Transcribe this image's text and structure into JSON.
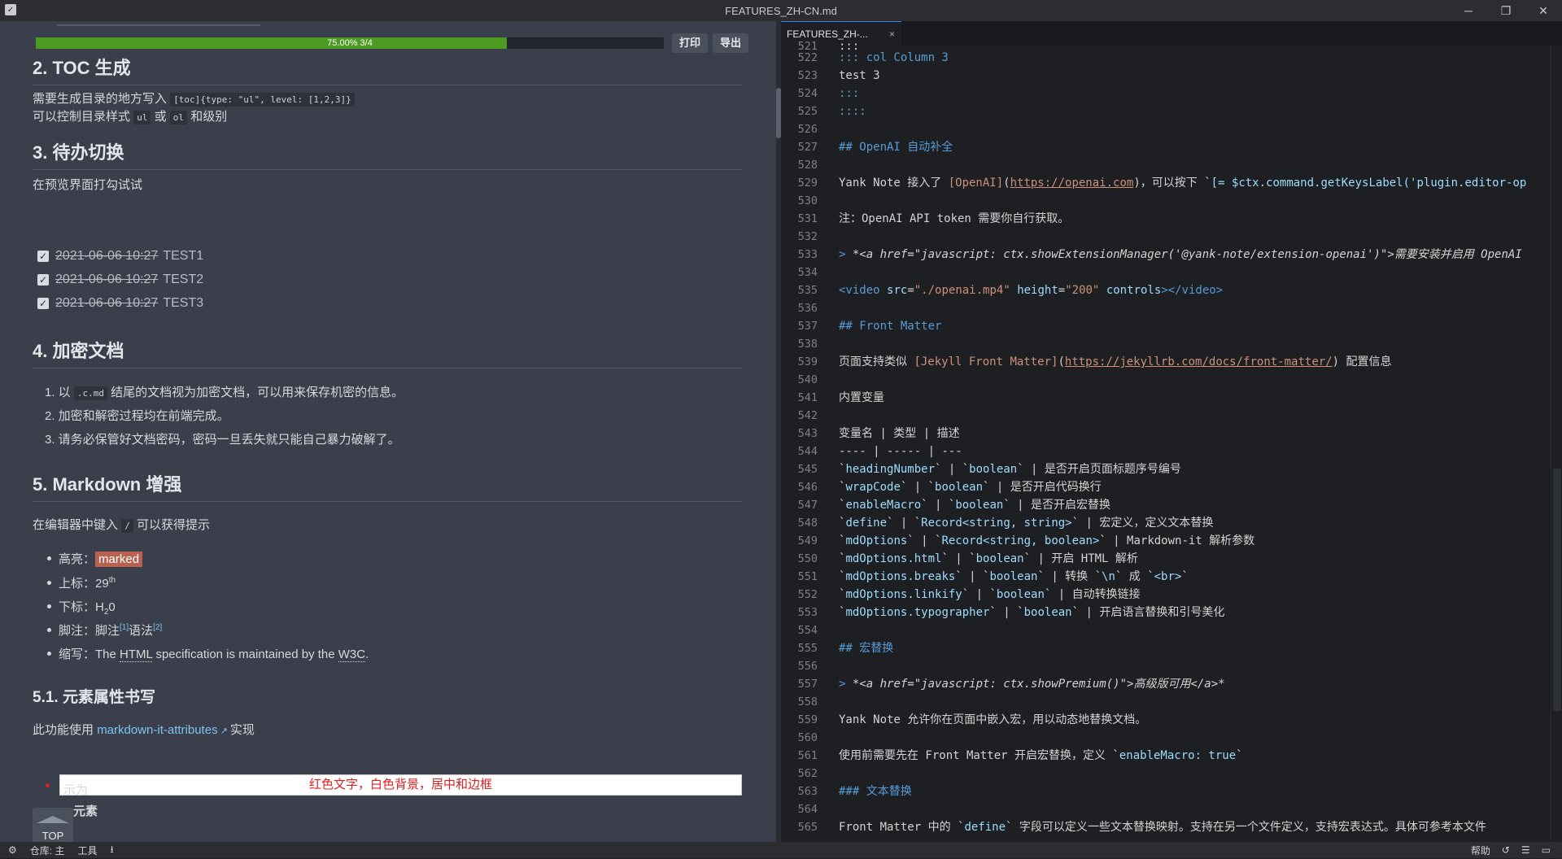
{
  "window": {
    "title": "FEATURES_ZH-CN.md",
    "minimize": "─",
    "maximize": "❐",
    "close": "✕"
  },
  "preview": {
    "progress": {
      "fraction": 0.75,
      "label": "75.00% 3/4"
    },
    "buttons": {
      "print": "打印",
      "export": "导出"
    },
    "sections": {
      "toc_heading": "2.  TOC 生成",
      "toc_line1_prefix": "需要生成目录的地方写入",
      "toc_line1_code": "[toc]{type: \"ul\", level: [1,2,3]}",
      "toc_line2_prefix": "可以控制目录样式",
      "toc_line2_code1": "ul",
      "toc_line2_mid": "或",
      "toc_line2_code2": "ol",
      "toc_line2_suffix": "和级别",
      "todo_heading": "3.  待办切换",
      "todo_intro": "在预览界面打勾试试",
      "tasks": [
        {
          "date": "2021-06-06 10:27",
          "name": "TEST1",
          "check": "✓"
        },
        {
          "date": "2021-06-06 10:27",
          "name": "TEST2",
          "check": "✓"
        },
        {
          "date": "2021-06-06 10:27",
          "name": "TEST3",
          "check": "✓"
        }
      ],
      "enc_heading": "4.  加密文档",
      "enc_items": {
        "i1_prefix": "1. 以",
        "i1_code": ".c.md",
        "i1_suffix": "结尾的文档视为加密文档，可以用来保存机密的信息。",
        "i2": "2. 加密和解密过程均在前端完成。",
        "i3": "3. 请务必保管好文档密码，密码一旦丢失就只能自己暴力破解了。"
      },
      "md_heading": "5.  Markdown 增强",
      "md_intro_prefix": "在编辑器中键入",
      "md_intro_code": "/",
      "md_intro_suffix": "可以获得提示",
      "md_items": {
        "highlight_label": "高亮：",
        "highlight_value": "marked",
        "sup_label": "上标：29",
        "sup_value": "th",
        "sub_label": "下标：H",
        "sub_value": "2",
        "sub_suffix": "0",
        "fn_label": "脚注：脚注",
        "fn_ref1": "[1]",
        "fn_mid": "语法",
        "fn_ref2": "[2]",
        "abbr_label": "缩写：The ",
        "abbr1": "HTML",
        "abbr_mid": " specification is maintained by the ",
        "abbr2": "W3C",
        "abbr_end": "."
      },
      "attr_heading": "5.1.  元素属性书写",
      "attr_intro_prefix": "此功能使用",
      "attr_intro_link": "markdown-it-attributes",
      "attr_intro_suffix": "实现",
      "red_box": "红色文字，白色背景，居中和边框",
      "partial1": "示为",
      "partial2": "元素"
    },
    "top_button": "TOP"
  },
  "editor": {
    "tab_label": "FEATURES_ZH-...",
    "tab_close": "×"
  },
  "statusbar": {
    "repo": "仓库: 主",
    "tools": "工具",
    "help": "帮助"
  }
}
